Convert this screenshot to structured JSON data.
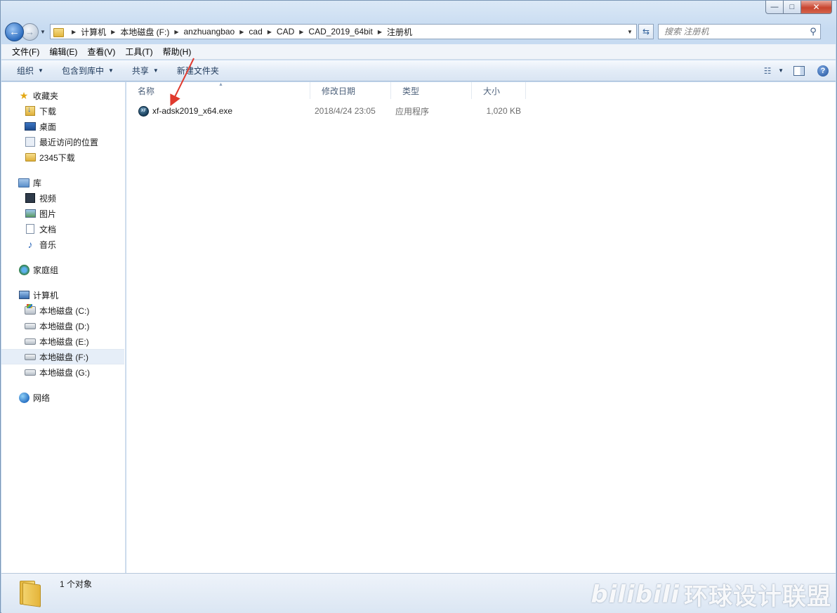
{
  "window": {
    "caption_buttons": {
      "minimize": "—",
      "maximize": "□",
      "close": "✕"
    }
  },
  "address": {
    "crumbs": [
      "计算机",
      "本地磁盘 (F:)",
      "anzhuangbao",
      "cad",
      "CAD",
      "CAD_2019_64bit",
      "注册机"
    ]
  },
  "search": {
    "placeholder": "搜索 注册机"
  },
  "menu": [
    "文件(F)",
    "编辑(E)",
    "查看(V)",
    "工具(T)",
    "帮助(H)"
  ],
  "commands": {
    "organize": "组织",
    "include_in_library": "包含到库中",
    "share": "共享",
    "new_folder": "新建文件夹"
  },
  "nav": {
    "favorites": {
      "label": "收藏夹",
      "items": [
        "下载",
        "桌面",
        "最近访问的位置",
        "2345下载"
      ]
    },
    "libraries": {
      "label": "库",
      "items": [
        "视频",
        "图片",
        "文档",
        "音乐"
      ]
    },
    "homegroup": {
      "label": "家庭组"
    },
    "computer": {
      "label": "计算机",
      "items": [
        "本地磁盘 (C:)",
        "本地磁盘 (D:)",
        "本地磁盘 (E:)",
        "本地磁盘 (F:)",
        "本地磁盘 (G:)"
      ],
      "selected": "本地磁盘 (F:)"
    },
    "network": {
      "label": "网络"
    }
  },
  "columns": {
    "name": "名称",
    "modified": "修改日期",
    "type": "类型",
    "size": "大小"
  },
  "files": [
    {
      "name": "xf-adsk2019_x64.exe",
      "modified": "2018/4/24 23:05",
      "type": "应用程序",
      "size": "1,020 KB"
    }
  ],
  "status": {
    "count": "1 个对象"
  },
  "watermark": {
    "logo": "bilibili",
    "text": "环球设计联盟"
  },
  "colors": {
    "annotation_arrow": "#e03a2e",
    "selected_nav": "#e6eef8"
  }
}
